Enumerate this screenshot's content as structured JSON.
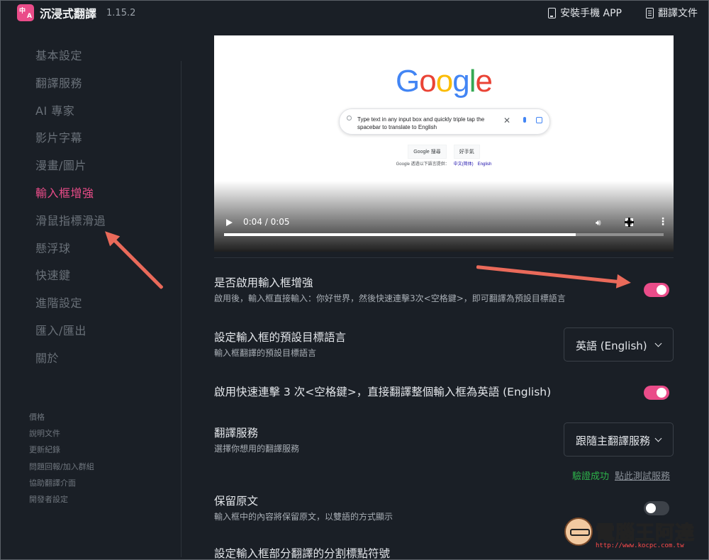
{
  "app": {
    "logo_text_top": "中",
    "logo_text_bottom": "A",
    "name": "沉浸式翻譯",
    "version": "1.15.2"
  },
  "header": {
    "install_app": "安裝手機 APP",
    "docs": "翻譯文件"
  },
  "sidebar": {
    "items": [
      {
        "label": "基本設定"
      },
      {
        "label": "翻譯服務"
      },
      {
        "label": "AI 專家"
      },
      {
        "label": "影片字幕"
      },
      {
        "label": "漫畫/圖片"
      },
      {
        "label": "輸入框增強"
      },
      {
        "label": "滑鼠指標滑過"
      },
      {
        "label": "懸浮球"
      },
      {
        "label": "快速鍵"
      },
      {
        "label": "進階設定"
      },
      {
        "label": "匯入/匯出"
      },
      {
        "label": "關於"
      }
    ],
    "active_index": 5,
    "footer": [
      "價格",
      "說明文件",
      "更新紀錄",
      "問題回報/加入群組",
      "協助翻譯介面",
      "開發者設定"
    ]
  },
  "video": {
    "google_logo": "Google",
    "search_text": "Type text in any input box and quickly triple tap the spacebar to translate to English",
    "btn_search": "Google 搜尋",
    "btn_lucky": "好手氣",
    "offered_in": "Google 透過以下語言提供：",
    "lang1": "中文(简体)",
    "lang2": "English",
    "time": "0:04 / 0:05",
    "progress": 0.8
  },
  "settings": {
    "enable": {
      "title": "是否啟用輸入框增強",
      "desc": "啟用後，輸入框直接輸入：你好世界，然後快速連擊3次<空格鍵>，即可翻譯為預設目標語言",
      "on": true
    },
    "target_lang": {
      "title": "設定輸入框的預設目標語言",
      "desc": "輸入框翻譯的預設目標語言",
      "value": "英語 (English)"
    },
    "triple_space": {
      "title": "啟用快速連擊 3 次<空格鍵>，直接翻譯整個輸入框為英語 (English)",
      "on": true
    },
    "service": {
      "title": "翻譯服務",
      "desc": "選擇你想用的翻譯服務",
      "value": "跟隨主翻譯服務",
      "verify_ok": "驗證成功",
      "test_link": "點此測試服務"
    },
    "keep_original": {
      "title": "保留原文",
      "desc": "輸入框中的內容將保留原文，以雙語的方式顯示",
      "on": false
    },
    "delimiter": {
      "title": "設定輸入框部分翻譯的分割標點符號"
    }
  },
  "watermark": {
    "text": "電腦王阿達",
    "url": "http://www.kocpc.com.tw"
  },
  "colors": {
    "accent": "#ea4c89",
    "background": "#1a1f26",
    "annotation_arrow": "#ea6a5a",
    "success": "#2db34a"
  }
}
